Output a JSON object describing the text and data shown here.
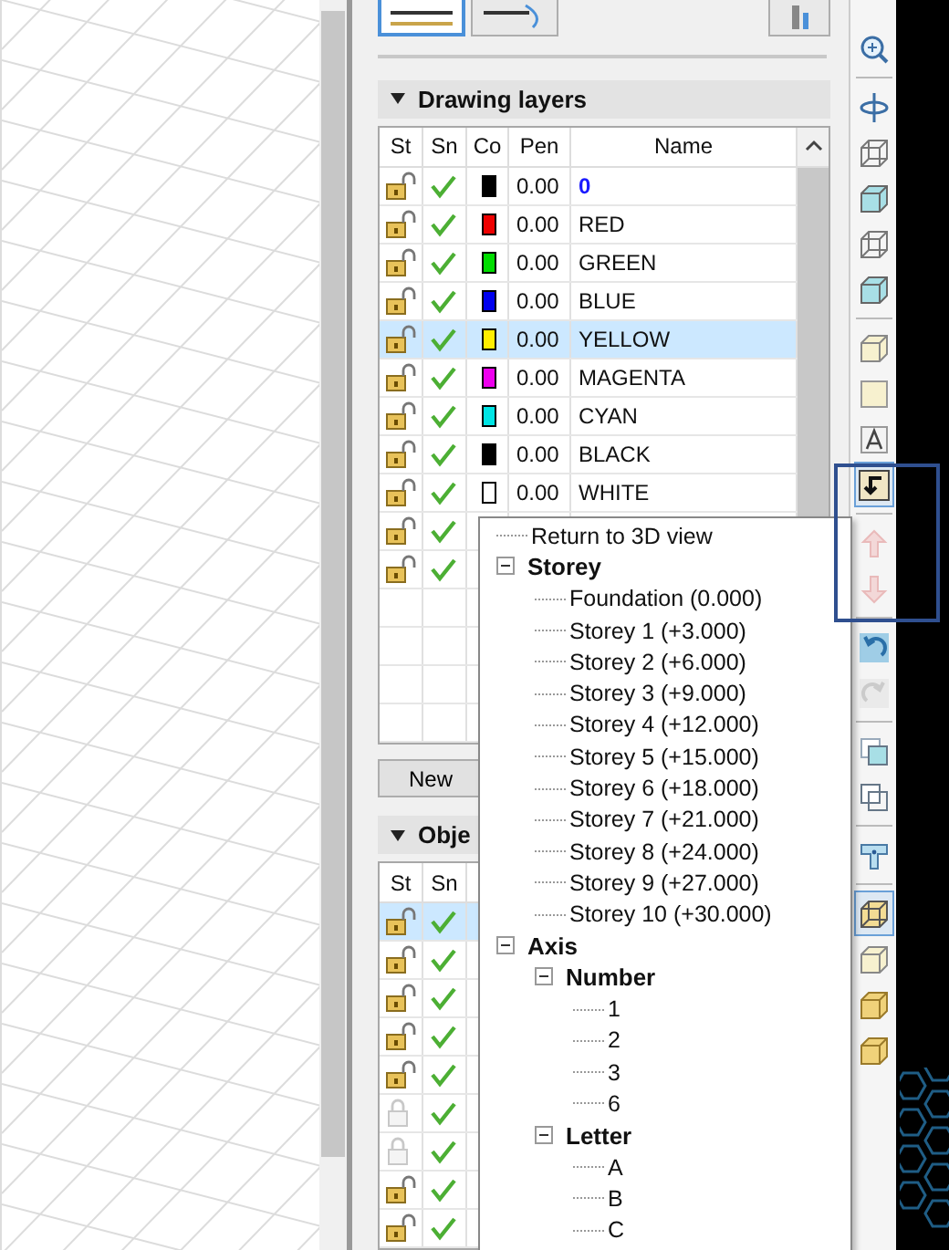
{
  "top_buttons": [
    {
      "kind": "lines",
      "selected": true
    },
    {
      "kind": "arc",
      "selected": false
    },
    {
      "kind": "pillar",
      "selected": false
    }
  ],
  "drawing_layers": {
    "title": "Drawing layers",
    "expanded": true,
    "columns": [
      "St",
      "Sn",
      "Co",
      "Pen",
      "Name"
    ],
    "rows": [
      {
        "locked": false,
        "snap": true,
        "color": "#000000",
        "pen": "0.00",
        "name": "0",
        "current": true,
        "selected": false
      },
      {
        "locked": false,
        "snap": true,
        "color": "#ee0000",
        "pen": "0.00",
        "name": "RED",
        "current": false,
        "selected": false
      },
      {
        "locked": false,
        "snap": true,
        "color": "#00dd00",
        "pen": "0.00",
        "name": "GREEN",
        "current": false,
        "selected": false
      },
      {
        "locked": false,
        "snap": true,
        "color": "#0000ee",
        "pen": "0.00",
        "name": "BLUE",
        "current": false,
        "selected": false
      },
      {
        "locked": false,
        "snap": true,
        "color": "#ffee00",
        "pen": "0.00",
        "name": "YELLOW",
        "current": false,
        "selected": true
      },
      {
        "locked": false,
        "snap": true,
        "color": "#ee00ee",
        "pen": "0.00",
        "name": "MAGENTA",
        "current": false,
        "selected": false
      },
      {
        "locked": false,
        "snap": true,
        "color": "#00e5e5",
        "pen": "0.00",
        "name": "CYAN",
        "current": false,
        "selected": false
      },
      {
        "locked": false,
        "snap": true,
        "color": "#000000",
        "pen": "0.00",
        "name": "BLACK",
        "current": false,
        "selected": false
      },
      {
        "locked": false,
        "snap": true,
        "color": "#ffffff",
        "pen": "0.00",
        "name": "WHITE",
        "current": false,
        "selected": false
      },
      {
        "locked": false,
        "snap": true,
        "selected": false
      },
      {
        "locked": false,
        "snap": true,
        "selected": false
      }
    ],
    "button": "New"
  },
  "objects": {
    "title": "Obje",
    "expanded": true,
    "columns": [
      "St",
      "Sn"
    ],
    "rows": [
      {
        "locked": false,
        "snap": true,
        "selected": true
      },
      {
        "locked": false,
        "snap": true,
        "selected": false
      },
      {
        "locked": false,
        "snap": true,
        "selected": false
      },
      {
        "locked": false,
        "snap": true,
        "selected": false
      },
      {
        "locked": false,
        "snap": true,
        "selected": false
      },
      {
        "locked": true,
        "snap": true,
        "selected": false
      },
      {
        "locked": true,
        "snap": true,
        "selected": false
      },
      {
        "locked": false,
        "snap": true,
        "selected": false
      },
      {
        "locked": false,
        "snap": true,
        "selected": false
      }
    ]
  },
  "view_menu": [
    {
      "label": "Return to 3D view"
    },
    {
      "label": "Storey",
      "expanded": true,
      "children": [
        {
          "label": "Foundation (0.000)"
        },
        {
          "label": "Storey 1 (+3.000)"
        },
        {
          "label": "Storey 2 (+6.000)"
        },
        {
          "label": "Storey 3 (+9.000)"
        },
        {
          "label": "Storey 4 (+12.000)"
        },
        {
          "label": "Storey 5 (+15.000)"
        },
        {
          "label": "Storey 6 (+18.000)"
        },
        {
          "label": "Storey 7 (+21.000)"
        },
        {
          "label": "Storey 8 (+24.000)"
        },
        {
          "label": "Storey 9 (+27.000)"
        },
        {
          "label": "Storey 10 (+30.000)"
        }
      ]
    },
    {
      "label": "Axis",
      "expanded": true,
      "children": [
        {
          "label": "Number",
          "expanded": true,
          "children": [
            {
              "label": "1"
            },
            {
              "label": "2"
            },
            {
              "label": "3"
            },
            {
              "label": "6"
            }
          ]
        },
        {
          "label": "Letter",
          "expanded": true,
          "children": [
            {
              "label": "A"
            },
            {
              "label": "B"
            },
            {
              "label": "C"
            }
          ]
        }
      ]
    }
  ],
  "toolbar": [
    {
      "kind": "zoom",
      "pressed": false,
      "disabled": false
    },
    {
      "kind": "separator"
    },
    {
      "kind": "orbit",
      "pressed": false,
      "disabled": false
    },
    {
      "kind": "wire-cube",
      "pressed": false,
      "disabled": false
    },
    {
      "kind": "cyan-cube",
      "pressed": false,
      "disabled": false
    },
    {
      "kind": "wire-cube",
      "pressed": false,
      "disabled": false
    },
    {
      "kind": "cyan-cube",
      "pressed": false,
      "disabled": false
    },
    {
      "kind": "separator"
    },
    {
      "kind": "cream-cube",
      "pressed": false,
      "disabled": false
    },
    {
      "kind": "square",
      "pressed": false,
      "disabled": false
    },
    {
      "kind": "letter",
      "pressed": false,
      "disabled": false
    },
    {
      "kind": "return",
      "pressed": true,
      "disabled": false
    },
    {
      "kind": "separator"
    },
    {
      "kind": "arrow-up",
      "pressed": false,
      "disabled": true
    },
    {
      "kind": "arrow-down",
      "pressed": false,
      "disabled": true
    },
    {
      "kind": "separator"
    },
    {
      "kind": "undo",
      "pressed": false,
      "disabled": false
    },
    {
      "kind": "redo",
      "pressed": false,
      "disabled": true
    },
    {
      "kind": "separator"
    },
    {
      "kind": "overlap-filled",
      "pressed": false,
      "disabled": false
    },
    {
      "kind": "overlap-outline",
      "pressed": false,
      "disabled": false
    },
    {
      "kind": "separator"
    },
    {
      "kind": "tee",
      "pressed": false,
      "disabled": false
    },
    {
      "kind": "separator"
    },
    {
      "kind": "frame-cube",
      "pressed": true,
      "disabled": false
    },
    {
      "kind": "cream-cube",
      "pressed": false,
      "disabled": false
    },
    {
      "kind": "gold-cube",
      "pressed": false,
      "disabled": false
    },
    {
      "kind": "gold-cube",
      "pressed": false,
      "disabled": false
    }
  ]
}
